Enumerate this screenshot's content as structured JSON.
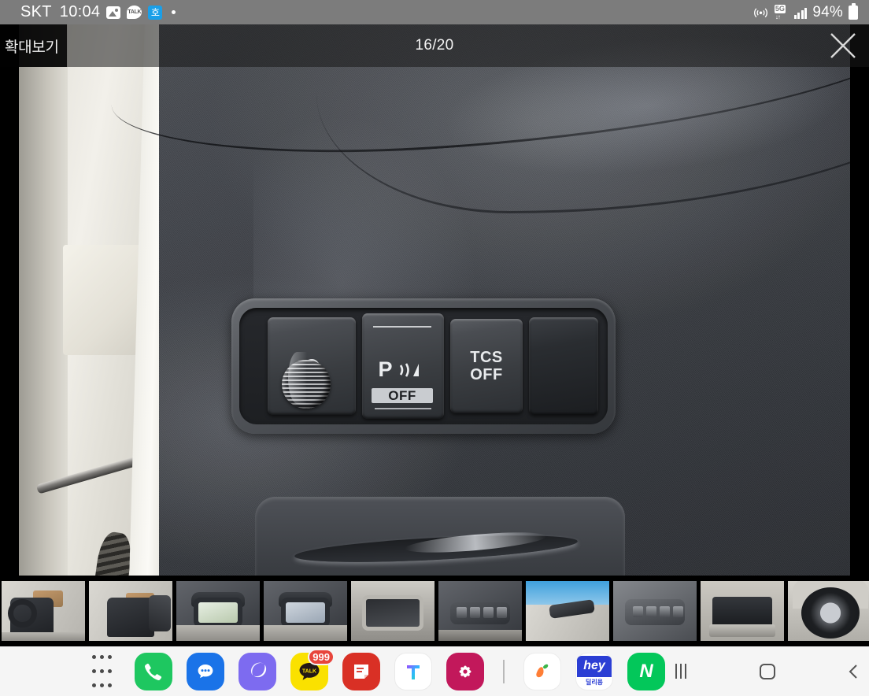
{
  "status_bar": {
    "carrier": "SKT",
    "time": "10:04",
    "battery_percent": "94%",
    "left_icons": [
      "gallery-icon",
      "kakaotalk-icon",
      "korean-app-icon",
      "more-dot-icon"
    ],
    "right_icons": [
      "hotspot-icon",
      "5g-icon",
      "signal-bars-icon",
      "battery-icon"
    ],
    "network_label": "5G",
    "background_color": "#7c7c7c"
  },
  "header": {
    "title": "확대보기",
    "counter": "16/20",
    "current_index": 16,
    "total": 20,
    "close_label": "닫기"
  },
  "photo": {
    "description": "자동차 실내 대시보드 스위치 패널 사진",
    "switches": [
      {
        "name": "instrument-dimmer",
        "label": "",
        "type": "knob"
      },
      {
        "name": "parking-sensor",
        "label": "P",
        "sub_label": "OFF",
        "type": "button"
      },
      {
        "name": "traction-control",
        "label_line1": "TCS",
        "label_line2": "OFF",
        "type": "button"
      },
      {
        "name": "blank-switch",
        "label": "",
        "type": "blank"
      }
    ]
  },
  "thumbnails": [
    {
      "index": 1,
      "name": "front-seat-interior",
      "selected": false
    },
    {
      "index": 2,
      "name": "rear-seat-interior",
      "selected": false
    },
    {
      "index": 3,
      "name": "navigation-screen-map",
      "selected": false
    },
    {
      "index": 4,
      "name": "navigation-screen-blank",
      "selected": false
    },
    {
      "index": 5,
      "name": "sunroof-ceiling",
      "selected": false
    },
    {
      "index": 6,
      "name": "door-switch-panel",
      "selected": true
    },
    {
      "index": 7,
      "name": "rearview-mirror",
      "selected": false
    },
    {
      "index": 8,
      "name": "window-control-panel",
      "selected": false
    },
    {
      "index": 9,
      "name": "trunk-cargo-area",
      "selected": false
    },
    {
      "index": 10,
      "name": "wheel-tire",
      "selected": false
    }
  ],
  "dock": {
    "apps": [
      {
        "name": "app-drawer",
        "label": "",
        "icon": "grid-icon",
        "color": "#ffffff"
      },
      {
        "name": "phone",
        "label": "",
        "icon": "phone-icon",
        "color": "#1ec760"
      },
      {
        "name": "messages",
        "label": "",
        "icon": "message-icon",
        "color": "#1a73e8"
      },
      {
        "name": "samsung-internet",
        "label": "",
        "icon": "browser-icon",
        "color": "#7d6bf0"
      },
      {
        "name": "kakaotalk",
        "label": "TALK",
        "icon": "kakaotalk-icon",
        "color": "#fae100",
        "badge": "999"
      },
      {
        "name": "memo",
        "label": "",
        "icon": "note-icon",
        "color": "#d93025"
      },
      {
        "name": "tmap",
        "label": "T",
        "icon": "tmap-icon",
        "color": "#ffffff"
      },
      {
        "name": "flower-app",
        "label": "",
        "icon": "flower-icon",
        "color": "#c2185b"
      }
    ],
    "apps_group2": [
      {
        "name": "karrot-market",
        "label": "",
        "icon": "carrot-icon",
        "color": "#ffffff"
      },
      {
        "name": "hey-dilliyong",
        "label": "hey",
        "sub_label": "딜리용",
        "icon": "hey-icon",
        "color": "#2b3ed4"
      },
      {
        "name": "naver",
        "label": "N",
        "icon": "naver-icon",
        "color": "#03c75a"
      }
    ],
    "nav": [
      {
        "name": "recents-button",
        "icon": "recents-icon"
      },
      {
        "name": "home-button",
        "icon": "home-icon"
      },
      {
        "name": "back-button",
        "icon": "back-icon"
      }
    ],
    "background_color": "#f5f5f5"
  }
}
